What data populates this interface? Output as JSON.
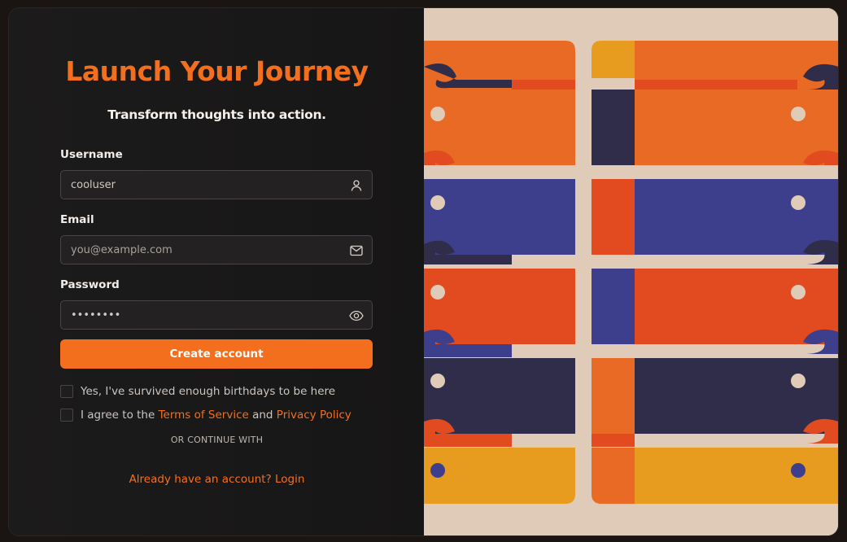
{
  "form": {
    "title": "Launch Your Journey",
    "subtitle": "Transform thoughts into action.",
    "username": {
      "label": "Username",
      "value": "cooluser",
      "icon": "user-icon"
    },
    "email": {
      "label": "Email",
      "placeholder": "you@example.com",
      "icon": "mail-icon"
    },
    "password": {
      "label": "Password",
      "value": "••••••••",
      "icon": "eye-icon"
    },
    "submit_label": "Create account",
    "age_check": {
      "label": "Yes, I've survived enough birthdays to be here",
      "checked": false
    },
    "terms_check": {
      "prefix": "I agree to the ",
      "terms_link": "Terms of Service",
      "middle": " and ",
      "privacy_link": "Privacy Policy",
      "checked": false
    },
    "divider": "OR CONTINUE WITH",
    "login_link": "Already have an account? Login"
  },
  "colors": {
    "accent": "#f36f1e",
    "panel_bg": "#1c1b1b",
    "art_cream": "#e0cbb8",
    "art_orange": "#e86a24",
    "art_red": "#e24a20",
    "art_navy": "#302d4a",
    "art_blue": "#3e3f8c",
    "art_yellow": "#e79b1f"
  }
}
